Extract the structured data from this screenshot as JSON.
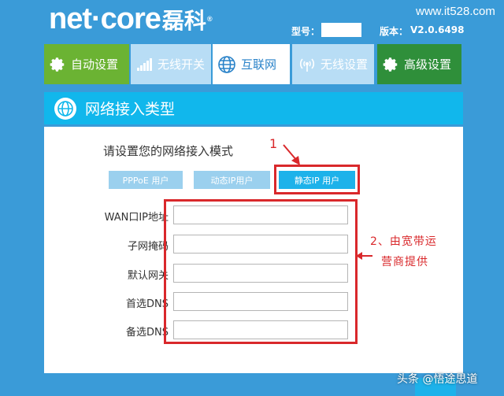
{
  "header": {
    "logo_text": "net·core",
    "logo_cn": "磊科",
    "logo_reg": "®",
    "model_label": "型号：",
    "version_label": "版本：",
    "version_value": "V2.0.6498",
    "watermark_url": "www.it528.com"
  },
  "nav": {
    "tabs": [
      {
        "label": "自动设置",
        "icon": "gear-icon"
      },
      {
        "label": "无线开关",
        "icon": "signal-bars-icon"
      },
      {
        "label": "互联网",
        "icon": "globe-icon"
      },
      {
        "label": "无线设置",
        "icon": "wifi-icon"
      },
      {
        "label": "高级设置",
        "icon": "gear-icon"
      }
    ],
    "active_index": 2
  },
  "section": {
    "title": "网络接入类型",
    "icon": "globe-icon"
  },
  "mode": {
    "prompt": "请设置您的网络接入模式",
    "buttons": [
      "PPPoE 用户",
      "动态IP用户",
      "静态IP 用户"
    ],
    "selected_index": 2
  },
  "fields": [
    {
      "label": "WAN口IP地址",
      "value": ""
    },
    {
      "label": "子网掩码",
      "value": ""
    },
    {
      "label": "默认网关",
      "value": ""
    },
    {
      "label": "首选DNS",
      "value": ""
    },
    {
      "label": "备选DNS",
      "value": ""
    }
  ],
  "annotations": {
    "step1": "1",
    "step2_line1": "2、由宽带运",
    "step2_line2": "营商提供"
  },
  "footer": {
    "watermark": "头条 @悟途思道"
  },
  "colors": {
    "background": "#3a9bd8",
    "auto_tab": "#6bb333",
    "advanced_tab": "#2f8f3a",
    "inactive_tab": "#b8ddf5",
    "accent": "#11b7ec",
    "highlight_red": "#d9282b"
  }
}
